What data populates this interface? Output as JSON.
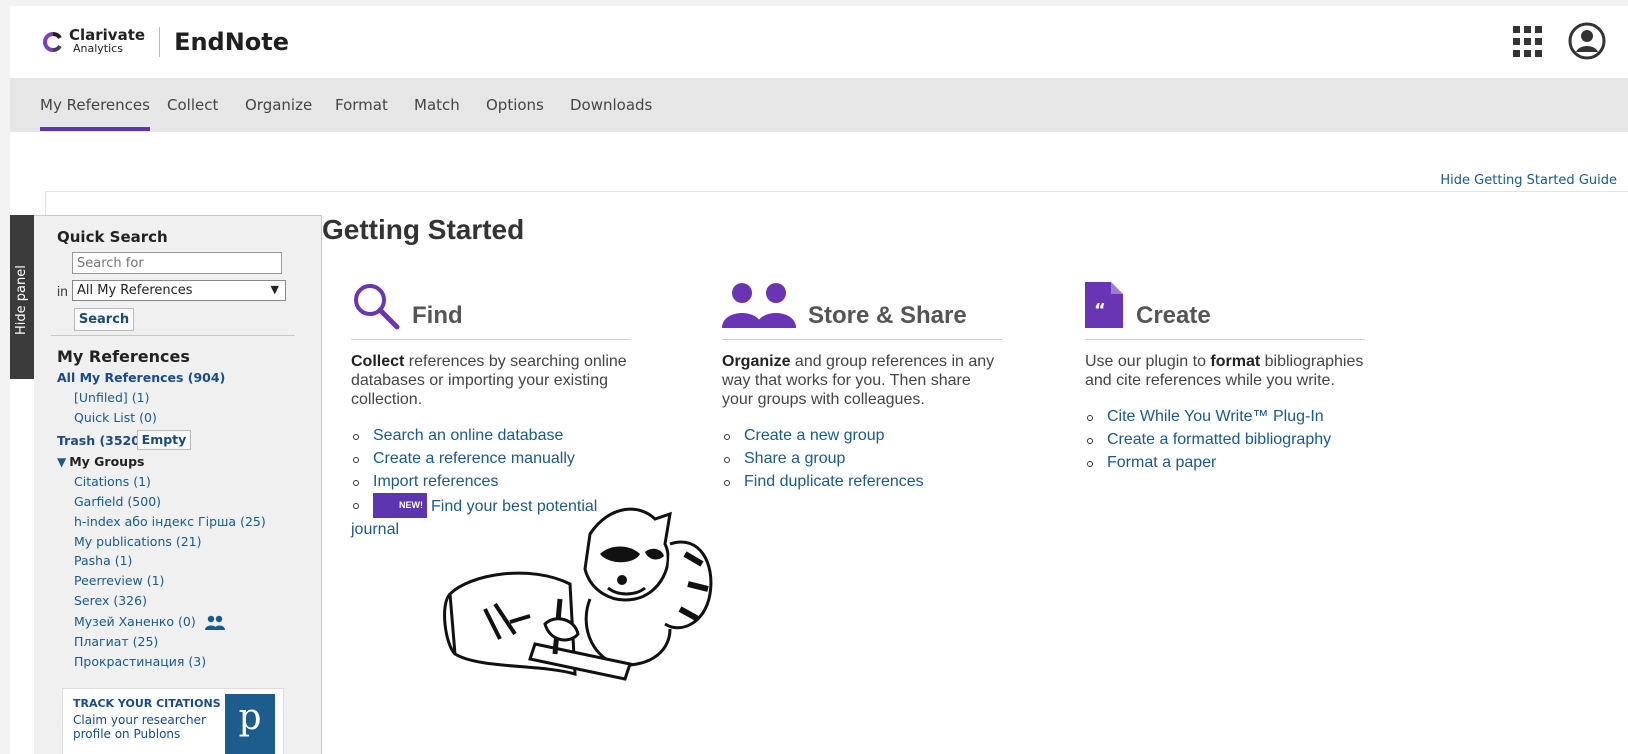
{
  "brand": {
    "company_line1": "Clarivate",
    "company_line2": "Analytics",
    "product": "EndNote",
    "accent": "#5e35b1"
  },
  "nav": {
    "items": [
      {
        "label": "My References",
        "active": true
      },
      {
        "label": "Collect"
      },
      {
        "label": "Organize"
      },
      {
        "label": "Format"
      },
      {
        "label": "Match"
      },
      {
        "label": "Options"
      },
      {
        "label": "Downloads"
      }
    ]
  },
  "guide_toggle": "Hide Getting Started Guide",
  "hide_panel": "Hide panel",
  "quick_search": {
    "title": "Quick Search",
    "placeholder": "Search for",
    "in_label": "in",
    "scope": "All My References",
    "button": "Search"
  },
  "my_references": {
    "title": "My References",
    "all": "All My References (904)",
    "unfiled": "[Unfiled] (1)",
    "quick_list": "Quick List (0)",
    "trash": "Trash (3520)",
    "empty_button": "Empty",
    "groups_title": "My Groups",
    "groups": [
      "Citations  (1)",
      "Garfield  (500)",
      "h-index або індекс Гірша  (25)",
      "My publications  (21)",
      "Pasha  (1)",
      "Peerreview  (1)",
      "Serex  (326)",
      "Музей Ханенко  (0)",
      "Плагиат  (25)",
      "Прокрастинация  (3)"
    ]
  },
  "promo": {
    "title": "TRACK YOUR CITATIONS",
    "text": "Claim your researcher profile on Publons",
    "logo_letter": "p"
  },
  "getting_started": {
    "title": "Getting Started",
    "find": {
      "heading": "Find",
      "desc_bold": "Collect",
      "desc_rest": " references by searching online databases or importing your existing collection.",
      "links": [
        "Search an online database",
        "Create a reference manually",
        "Import references"
      ],
      "new_badge": "NEW!",
      "new_link": "Find your best potential journal"
    },
    "store": {
      "heading": "Store & Share",
      "desc_bold": "Organize",
      "desc_rest": " and group references in any way that works for you. Then share your groups with colleagues.",
      "links": [
        "Create a new group",
        "Share a group",
        "Find duplicate references"
      ]
    },
    "create": {
      "heading": "Create",
      "desc_pre": "Use our plugin to ",
      "desc_bold": "format",
      "desc_rest": " bibliographies and cite references while you write.",
      "links": [
        "Cite While You Write™ Plug-In",
        "Create a formatted bibliography",
        "Format a paper"
      ]
    }
  }
}
